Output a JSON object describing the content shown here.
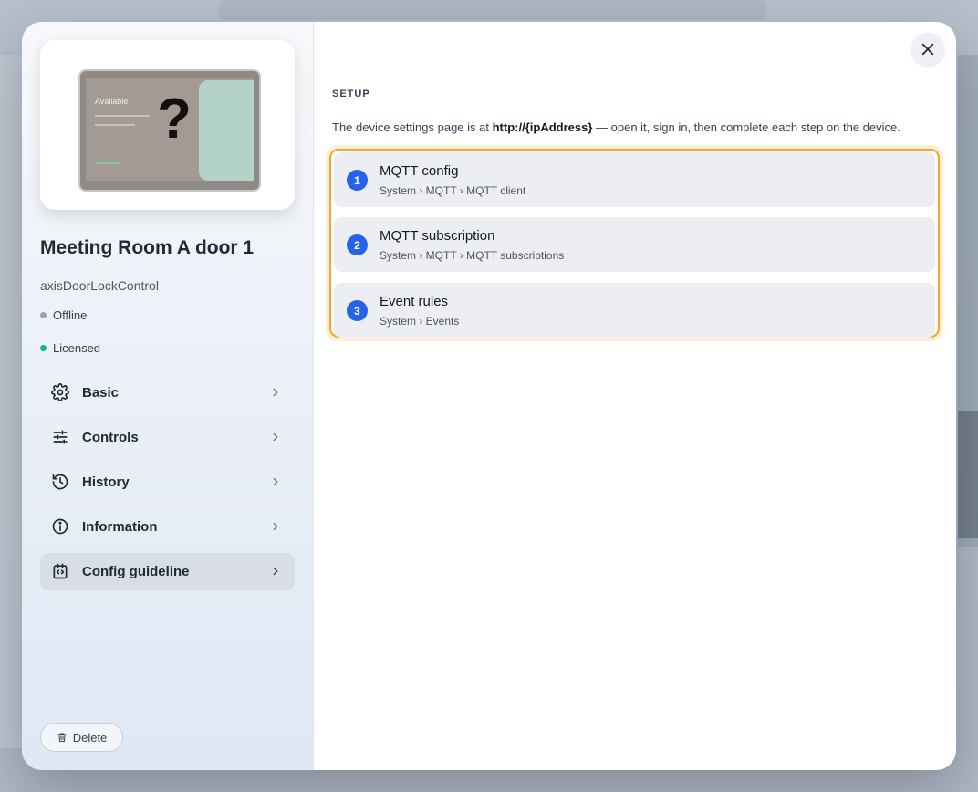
{
  "device": {
    "name": "Meeting Room A door 1",
    "type": "axisDoorLockControl",
    "image_text": "Available",
    "statuses": [
      {
        "label": "Offline",
        "color": "#9ca3af"
      },
      {
        "label": "Licensed",
        "color": "#10b981"
      }
    ]
  },
  "nav": {
    "items": [
      {
        "label": "Basic",
        "icon": "gear-icon"
      },
      {
        "label": "Controls",
        "icon": "sliders-icon"
      },
      {
        "label": "History",
        "icon": "history-icon"
      },
      {
        "label": "Information",
        "icon": "info-icon"
      },
      {
        "label": "Config guideline",
        "icon": "config-icon",
        "active": true
      }
    ]
  },
  "delete_label": "Delete",
  "setup": {
    "section_label": "SETUP",
    "intro_prefix": "The device settings page is at ",
    "intro_address": "http://{ipAddress}",
    "intro_suffix": " — open it, sign in, then complete each step on the device.",
    "steps": [
      {
        "number": "1",
        "title": "MQTT config",
        "path": "System › MQTT › MQTT client"
      },
      {
        "number": "2",
        "title": "MQTT subscription",
        "path": "System › MQTT › MQTT subscriptions"
      },
      {
        "number": "3",
        "title": "Event rules",
        "path": "System › Events"
      }
    ]
  },
  "colors": {
    "accent_blue": "#2563eb",
    "highlight_orange": "#f5a623",
    "offline": "#9ca3af",
    "licensed": "#10b981"
  }
}
